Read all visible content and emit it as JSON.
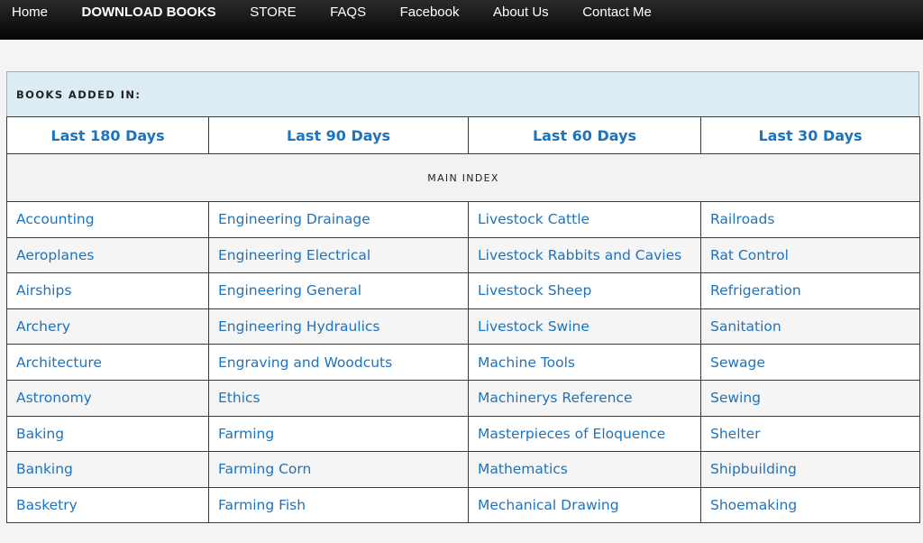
{
  "nav": [
    {
      "label": "Home",
      "bold": false
    },
    {
      "label": "DOWNLOAD BOOKS",
      "bold": true
    },
    {
      "label": "STORE",
      "bold": false
    },
    {
      "label": "FAQS",
      "bold": false
    },
    {
      "label": "Facebook",
      "bold": false
    },
    {
      "label": "About Us",
      "bold": false
    },
    {
      "label": "Contact Me",
      "bold": false
    }
  ],
  "books_added_label": "BOOKS ADDED IN:",
  "periods": [
    "Last 180 Days",
    "Last 90 Days",
    "Last 60 Days",
    "Last 30 Days"
  ],
  "main_index_label": "MAIN INDEX",
  "categories": [
    [
      "Accounting",
      "Engineering Drainage",
      "Livestock Cattle",
      "Railroads"
    ],
    [
      "Aeroplanes",
      "Engineering Electrical",
      "Livestock Rabbits and Cavies",
      "Rat Control"
    ],
    [
      "Airships",
      "Engineering General",
      "Livestock Sheep",
      "Refrigeration"
    ],
    [
      "Archery",
      "Engineering Hydraulics",
      "Livestock Swine",
      "Sanitation"
    ],
    [
      "Architecture",
      "Engraving and Woodcuts",
      "Machine Tools",
      "Sewage"
    ],
    [
      "Astronomy",
      "Ethics",
      "Machinerys Reference",
      "Sewing"
    ],
    [
      "Baking",
      "Farming",
      "Masterpieces of Eloquence",
      "Shelter"
    ],
    [
      "Banking",
      "Farming Corn",
      "Mathematics",
      "Shipbuilding"
    ],
    [
      "Basketry",
      "Farming Fish",
      "Mechanical Drawing",
      "Shoemaking"
    ]
  ],
  "colors": {
    "link": "#1f73bb",
    "header_bg": "#dcecf5",
    "nav_bg": "#111111"
  }
}
